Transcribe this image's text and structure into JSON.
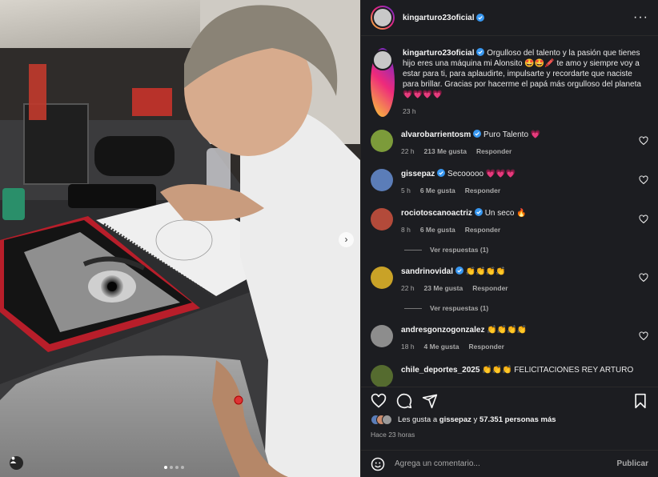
{
  "post": {
    "username": "kingarturo23oficial",
    "more_icon": "more-horizontal-icon",
    "caption": "Orgulloso del talento y la pasión que tienes hijo eres una máquina mi Alonsito 🤩🤩🖍️ te amo y siempre voy a estar para ti, para aplaudirte, impulsarte y recordarte que naciste para brillar. Gracias por hacerme el papá más orgulloso del planeta 💗💗💗💗",
    "caption_time": "23 h"
  },
  "comments": [
    {
      "username": "alvarobarrientosm",
      "verified": true,
      "text": "Puro Talento 💗",
      "time": "22 h",
      "likes": "213 Me gusta",
      "reply": "Responder",
      "avatar_color": "#7c9b3a"
    },
    {
      "username": "gissepaz",
      "verified": true,
      "text": "Secooooo 💗💗💗",
      "time": "5 h",
      "likes": "6 Me gusta",
      "reply": "Responder",
      "avatar_color": "#5b7db8"
    },
    {
      "username": "rociotoscanoactriz",
      "verified": true,
      "text": "Un seco 🔥",
      "time": "8 h",
      "likes": "6 Me gusta",
      "reply": "Responder",
      "view_replies": "Ver respuestas (1)",
      "avatar_color": "#b34a3a"
    },
    {
      "username": "sandrinovidal",
      "verified": true,
      "text": "👏👏👏👏",
      "time": "22 h",
      "likes": "23 Me gusta",
      "reply": "Responder",
      "view_replies": "Ver respuestas (1)",
      "avatar_color": "#c9a227"
    },
    {
      "username": "andresgonzogonzalez",
      "verified": false,
      "text": "👏👏👏👏",
      "time": "18 h",
      "likes": "4 Me gusta",
      "reply": "Responder",
      "avatar_color": "#8d8d8d"
    },
    {
      "username": "chile_deportes_2025",
      "verified": false,
      "text": "👏👏👏 FELICITACIONES REY ARTURO",
      "avatar_color": "#556b2f"
    }
  ],
  "actions": {
    "like_icon": "heart-icon",
    "comment_icon": "comment-icon",
    "share_icon": "share-icon",
    "save_icon": "bookmark-icon"
  },
  "likes_summary": {
    "prefix": "Les gusta a ",
    "user": "gissepaz",
    "middle": " y ",
    "count": "57.351 personas más"
  },
  "post_time": "Hace 23 horas",
  "composer": {
    "emoji_icon": "smiley-icon",
    "placeholder": "Agrega un comentario...",
    "publish_label": "Publicar"
  },
  "photo": {
    "next_icon": "chevron-right-icon",
    "tag_icon": "person-icon",
    "carousel_index": 1,
    "carousel_count": 4
  },
  "colors": {
    "panel_bg": "#1c1d21",
    "verified_blue": "#3897f0",
    "muted_text": "#a8a8a8"
  }
}
